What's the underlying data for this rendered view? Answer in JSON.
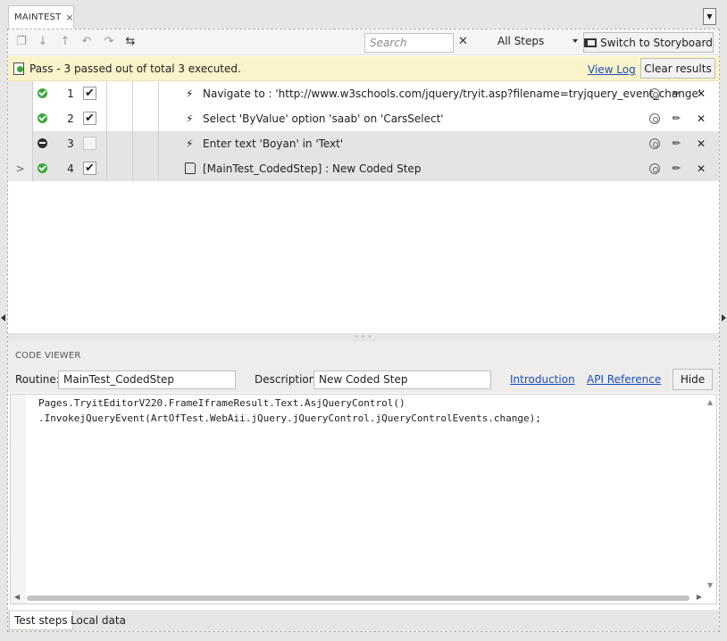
{
  "document_tab": {
    "label": "MAINTEST",
    "close": "×"
  },
  "menu_dropdown": "▼",
  "toolbar": {
    "search_placeholder": "Search",
    "search_clear": "✕",
    "filter_selected": "All Steps",
    "storyboard_label": "Switch to Storyboard"
  },
  "status": {
    "message": "Pass - 3 passed out of total 3 executed.",
    "view_log": "View Log",
    "clear_results": "Clear results",
    "color": "#fbf3c9"
  },
  "steps": [
    {
      "num": "1",
      "result": "passed",
      "checked": "✔",
      "description": "Navigate to : 'http://www.w3schools.com/jquery/tryit.asp?filename=tryjquery_event_change'",
      "icon": "lightning-icon",
      "type_glyph": "⚡"
    },
    {
      "num": "2",
      "result": "passed",
      "checked": "✔",
      "description": "Select 'ByValue' option 'saab' on 'CarsSelect'",
      "icon": "lightning-icon",
      "type_glyph": "⚡"
    },
    {
      "num": "3",
      "result": "not-run",
      "checked": "",
      "description": "Enter text 'Boyan' in 'Text'",
      "icon": "lightning-icon",
      "type_glyph": "⚡"
    },
    {
      "num": "4",
      "result": "passed",
      "checked": "✔",
      "description": "[MainTest_CodedStep] : New Coded Step",
      "icon": "coded-step-icon",
      "expander": ">"
    }
  ],
  "code_viewer": {
    "title": "CODE VIEWER",
    "routine_label": "Routine:",
    "routine_value": "MainTest_CodedStep",
    "description_label": "Description:",
    "description_value": "New Coded Step",
    "link_intro": "Introduction",
    "link_api": "API Reference",
    "hide": "Hide",
    "code_line1": "Pages.TryitEditorV220.FrameIframeResult.Text.AsjQueryControl()",
    "code_line2": ".InvokejQueryEvent(ArtOfTest.WebAii.jQuery.jQueryControl.jQueryControlEvents.change);"
  },
  "bottom_tabs": {
    "test_steps": "Test steps",
    "local_data": "Local data"
  },
  "colors": {
    "pass_green": "#3aa63a",
    "link_blue": "#1a4fbf"
  }
}
